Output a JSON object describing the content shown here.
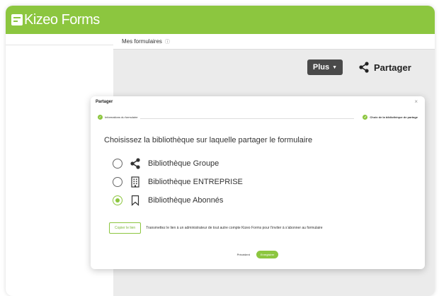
{
  "app": {
    "logo_text": "Kizeo Forms",
    "brand_color": "#8cc63f",
    "logo_icon": "form-icon"
  },
  "subheader": {
    "title": "Mes formulaires",
    "info_icon": "info-icon"
  },
  "toolbar": {
    "plus_label": "Plus",
    "share_label": "Partager",
    "share_icon": "share-icon"
  },
  "modal": {
    "title": "Partager",
    "close_symbol": "×",
    "steps": [
      {
        "label": "Informations du formulaire",
        "icon": "check-icon"
      },
      {
        "label": "Choix de la bibliothèque de partage",
        "icon": "check-icon"
      }
    ],
    "question": "Choisissez la bibliothèque sur laquelle partager le formulaire",
    "options": [
      {
        "label": "Bibliothèque Groupe",
        "icon": "share-icon",
        "selected": false
      },
      {
        "label": "Bibliothèque ENTREPRISE",
        "icon": "building-icon",
        "selected": false
      },
      {
        "label": "Bibliothèque Abonnés",
        "icon": "bookmark-icon",
        "selected": true
      }
    ],
    "copy_button": "Copier le lien",
    "copy_text": "Transmettez le lien à un administrateur de tout autre compte Kizeo Forms pour l’inviter à s’abonner au formulaire",
    "prev_label": "Précédent",
    "save_label": "Enregistrer"
  }
}
